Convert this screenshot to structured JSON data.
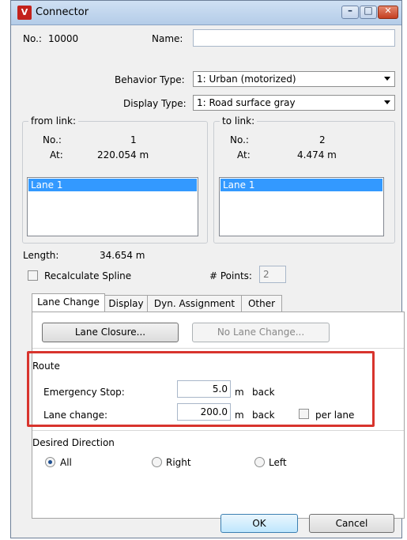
{
  "window": {
    "title": "Connector",
    "icon": "app-logo-icon",
    "controls": {
      "minimize": "minimize-icon",
      "maximize": "maximize-icon",
      "close": "close-icon"
    }
  },
  "header": {
    "no_label": "No.:",
    "no_value": "10000",
    "name_label": "Name:",
    "name_value": "",
    "behavior_label": "Behavior Type:",
    "behavior_value": "1: Urban (motorized)",
    "display_label": "Display Type:",
    "display_value": "1: Road surface gray"
  },
  "from_link": {
    "title": "from link:",
    "no_label": "No.:",
    "no_value": "1",
    "at_label": "At:",
    "at_value": "220.054 m",
    "lanes": [
      "Lane 1"
    ]
  },
  "to_link": {
    "title": "to link:",
    "no_label": "No.:",
    "no_value": "2",
    "at_label": "At:",
    "at_value": "4.474 m",
    "lanes": [
      "Lane 1"
    ]
  },
  "geometry": {
    "length_label": "Length:",
    "length_value": "34.654 m",
    "recalc_label": "Recalculate Spline",
    "recalc_checked": false,
    "points_label": "# Points:",
    "points_value": "2"
  },
  "tabs": [
    {
      "label": "Lane Change",
      "active": true
    },
    {
      "label": "Display",
      "active": false
    },
    {
      "label": "Dyn. Assignment",
      "active": false
    },
    {
      "label": "Other",
      "active": false
    }
  ],
  "lane_change": {
    "lane_closure_label": "Lane Closure...",
    "no_lane_change_label": "No Lane Change...",
    "route_title": "Route",
    "emergency_label": "Emergency Stop:",
    "emergency_value": "5.0",
    "emergency_unit": "m",
    "emergency_suffix": "back",
    "lane_change_label": "Lane change:",
    "lane_change_value": "200.0",
    "lane_change_unit": "m",
    "lane_change_suffix": "back",
    "per_lane_label": "per lane",
    "per_lane_checked": false,
    "direction_title": "Desired Direction",
    "directions": [
      {
        "label": "All",
        "selected": true
      },
      {
        "label": "Right",
        "selected": false
      },
      {
        "label": "Left",
        "selected": false
      }
    ]
  },
  "footer": {
    "ok_label": "OK",
    "cancel_label": "Cancel"
  },
  "colors": {
    "highlight": "#d8342d",
    "selection": "#3399ff",
    "accent": "#3c7fb1"
  }
}
